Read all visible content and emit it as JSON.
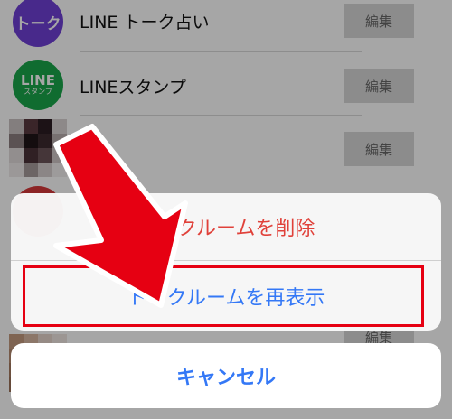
{
  "chat_list": {
    "rows": [
      {
        "name": "LINE トーク占い",
        "avatar_text": "トーク",
        "edit_label": "編集"
      },
      {
        "name": "LINEスタンプ",
        "avatar_text_top": "LINE",
        "avatar_text_bottom": "スタンプ",
        "edit_label": "編集"
      },
      {
        "name": "",
        "edit_label": "編集"
      }
    ],
    "bottom_edit_label": "編集"
  },
  "action_sheet": {
    "delete_label": "トークルームを削除",
    "restore_label": "トークルームを再表示",
    "cancel_label": "キャンセル"
  },
  "colors": {
    "delete_text": "#e0413a",
    "action_text": "#3478f6",
    "highlight_border": "#e60012",
    "arrow": "#e60012"
  }
}
